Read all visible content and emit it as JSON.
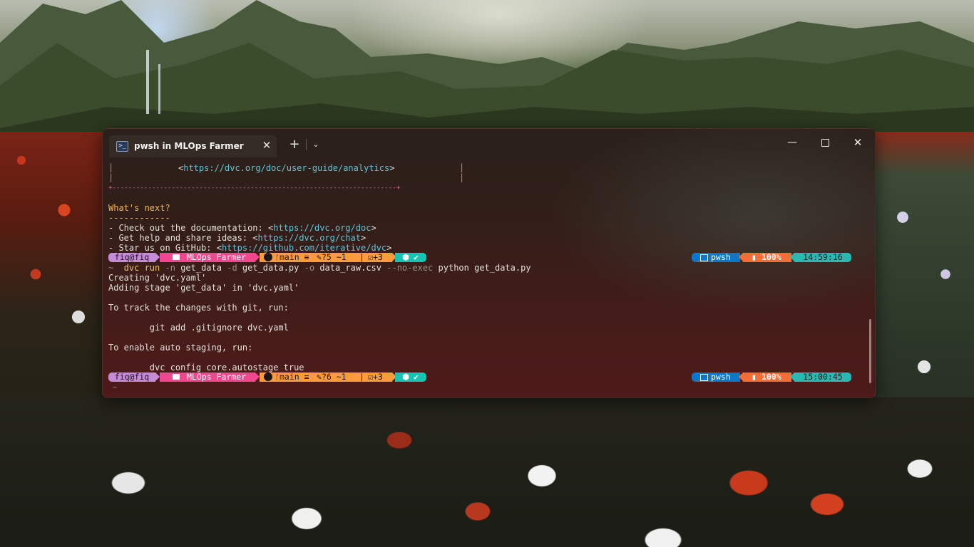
{
  "window": {
    "tab_title": "pwsh in MLOps Farmer",
    "tab_icon": "powershell-icon",
    "tab_icon_glyph": ">_",
    "new_tab_label": "+",
    "dropdown_label": "⌄",
    "minimize_label": "—",
    "close_label": "✕"
  },
  "terminal": {
    "box_link_prefix": "<",
    "analytics_link": "https://dvc.org/doc/user-guide/analytics",
    "box_link_suffix": ">",
    "box_bottom": "+------------------------------------------------------------------------+",
    "whats_next": "What's next?",
    "whats_next_underline": "------------",
    "next1_text": "- Check out the documentation: <",
    "next1_link": "https://dvc.org/doc",
    "next2_text": "- Get help and share ideas: <",
    "next2_link": "https://dvc.org/chat",
    "next3_text": "- Star us on GitHub: <",
    "next3_link": "https://github.com/iterative/dvc",
    "close_bracket": ">",
    "tilde": "~",
    "command": {
      "cmd": "dvc run",
      "flag_n": "-n",
      "arg_n": "get_data",
      "flag_d": "-d",
      "arg_d": "get_data.py",
      "flag_o": "-o",
      "arg_o": "data_raw.csv",
      "flag_noexec": "--no-exec",
      "rest": "python get_data.py"
    },
    "out1": "Creating 'dvc.yaml'",
    "out2": "Adding stage 'get_data' in 'dvc.yaml'",
    "out3": "To track the changes with git, run:",
    "out4": "        git add .gitignore dvc.yaml",
    "out5": "To enable auto staging, run:",
    "out6": "        dvc config core.autostage true"
  },
  "prompt1": {
    "user": "fiq@fiq",
    "folder": "MLOps Farmer",
    "git": "main ≡ ",
    "changes": "?5 ~1",
    "staged": "+3",
    "shell": "pwsh",
    "battery": "100%",
    "time": "14:59:16"
  },
  "prompt2": {
    "user": "fiq@fiq",
    "folder": "MLOps Farmer",
    "git": "main ≡ ",
    "changes": "?6 ~1",
    "staged": "+3",
    "shell": "pwsh",
    "battery": "100%",
    "time": "15:00:45"
  },
  "colors": {
    "user_segment": "#c58bd6",
    "folder_segment": "#f1478f",
    "git_segment": "#fb9b3c",
    "node_segment": "#17c3b2",
    "shell_segment": "#0a77c9",
    "battery_segment": "#f36d36",
    "time_segment": "#29b9b1"
  }
}
